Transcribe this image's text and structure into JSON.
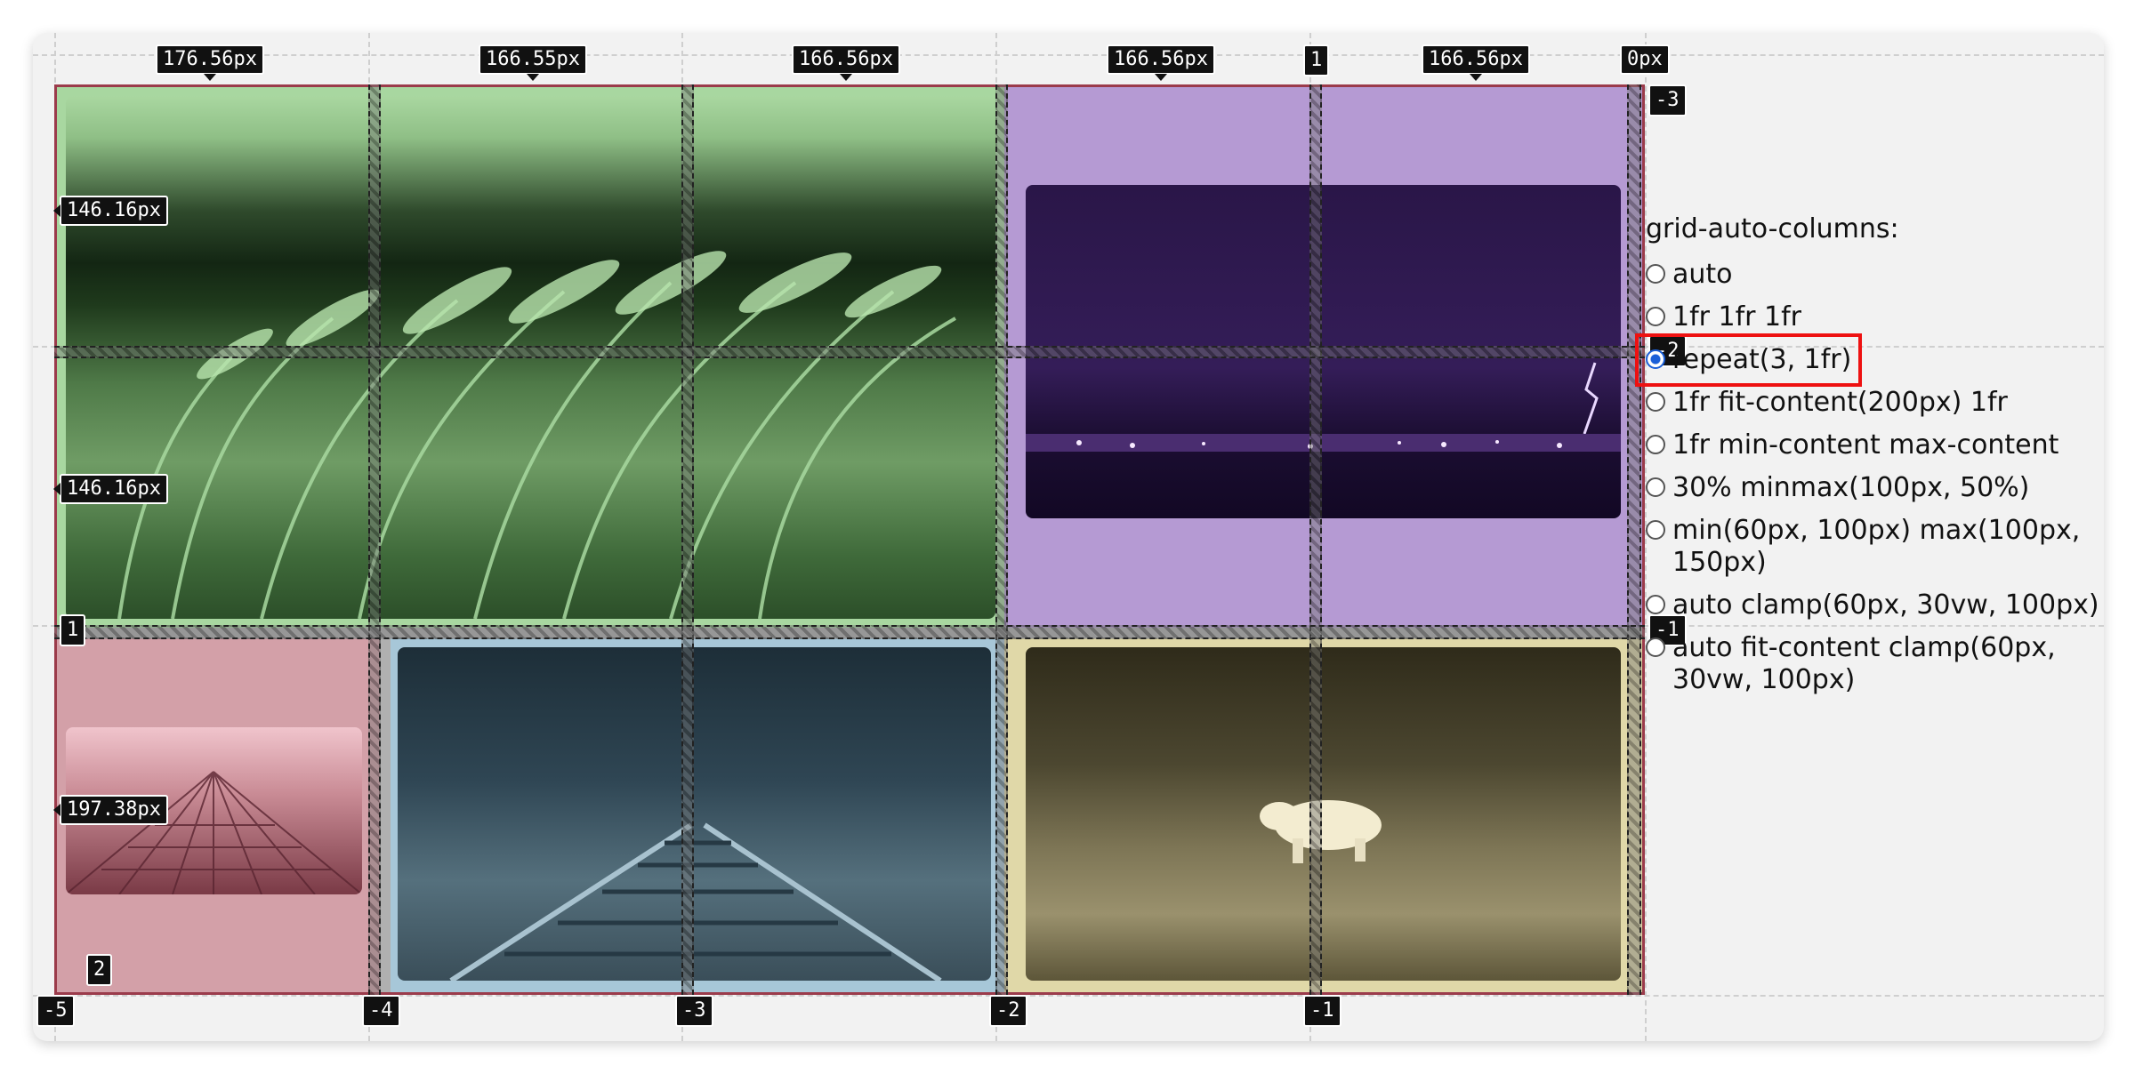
{
  "window": {
    "accent": "#e11111"
  },
  "column_tracks": [
    "176.56px",
    "166.55px",
    "166.56px",
    "166.56px",
    "1",
    "166.56px",
    "0px"
  ],
  "row_tracks": [
    "146.16px",
    "146.16px",
    "1",
    "197.38px",
    "2"
  ],
  "line_numbers_right": [
    "-3",
    "-2",
    "-1"
  ],
  "line_numbers_bottom": [
    "-5",
    "-4",
    "-3",
    "-2",
    "-1"
  ],
  "cells": [
    {
      "name": "grass-photo-cell",
      "tint": "#a8d7a0",
      "photo": "grass field"
    },
    {
      "name": "lightning-photo-cell",
      "tint": "#b59ad3",
      "photo": "night city lightning"
    },
    {
      "name": "building-photo-cell",
      "tint": "#d3a0a8",
      "photo": "skyscraper"
    },
    {
      "name": "railroad-photo-cell",
      "tint": "#a7c7d8",
      "photo": "railroad tracks"
    },
    {
      "name": "polar-bear-photo-cell",
      "tint": "#e0d8a8",
      "photo": "polar bear"
    }
  ],
  "panel": {
    "title": "grid-auto-columns:",
    "options": [
      {
        "label": "auto",
        "selected": false
      },
      {
        "label": "1fr 1fr 1fr",
        "selected": false
      },
      {
        "label": "repeat(3, 1fr)",
        "selected": true
      },
      {
        "label": "1fr fit-content(200px) 1fr",
        "selected": false
      },
      {
        "label": "1fr min-content max-content",
        "selected": false
      },
      {
        "label": "30% minmax(100px, 50%)",
        "selected": false
      },
      {
        "label": "min(60px, 100px) max(100px, 150px)",
        "selected": false
      },
      {
        "label": "auto clamp(60px, 30vw, 100px)",
        "selected": false
      },
      {
        "label": "auto fit-content clamp(60px, 30vw, 100px)",
        "selected": false
      }
    ]
  }
}
